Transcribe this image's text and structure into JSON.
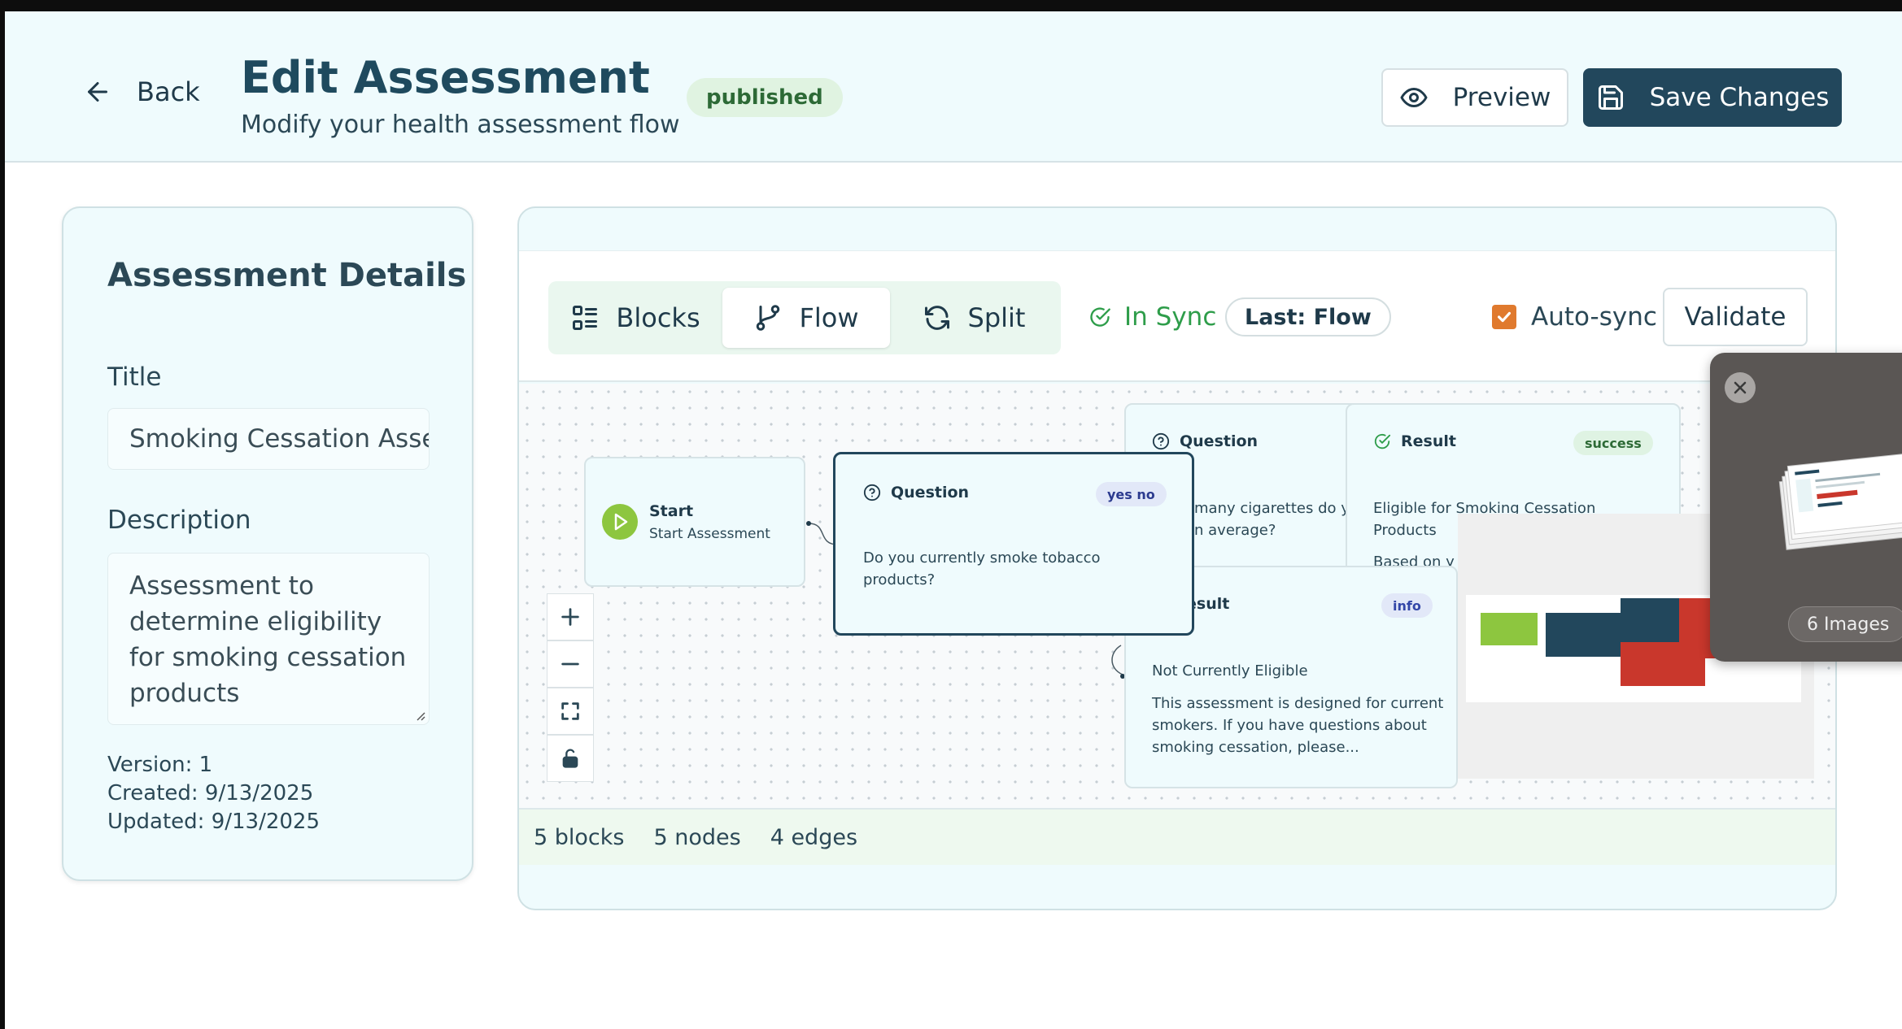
{
  "header": {
    "back_label": "Back",
    "title": "Edit Assessment",
    "subtitle": "Modify your health assessment flow",
    "status_badge": "published",
    "preview_label": "Preview",
    "save_label": "Save Changes"
  },
  "details": {
    "heading": "Assessment Details",
    "title_label": "Title",
    "title_value": "Smoking Cessation Assessment",
    "description_label": "Description",
    "description_value": "Assessment to determine eligibility for smoking cessation products",
    "version": "Version: 1",
    "created": "Created: 9/13/2025",
    "updated": "Updated: 9/13/2025"
  },
  "editor": {
    "tabs": [
      {
        "label": "Blocks",
        "icon": "blocks-icon"
      },
      {
        "label": "Flow",
        "icon": "flow-icon",
        "active": true
      },
      {
        "label": "Split",
        "icon": "split-icon"
      }
    ],
    "sync_status": "In Sync",
    "last_label": "Last: Flow",
    "autosync_label": "Auto-sync",
    "autosync_checked": true,
    "validate_label": "Validate",
    "footer": {
      "blocks": "5 blocks",
      "nodes": "5 nodes",
      "edges": "4 edges"
    }
  },
  "flow": {
    "start_node": {
      "title": "Start",
      "subtitle": "Start Assessment"
    },
    "question_main": {
      "title": "Question",
      "badge": "yes no",
      "text": "Do you currently smoke tobacco products?"
    },
    "question_2": {
      "title": "Question",
      "text_line1": "many cigarettes do yo",
      "text_line2": "n average?"
    },
    "result_success": {
      "title": "Result",
      "badge": "success",
      "text": "Eligible for Smoking Cessation Products",
      "detail": "Based on y"
    },
    "result_info": {
      "title": "esult",
      "badge": "info",
      "text": "Not Currently Eligible",
      "detail": "This assessment is designed for current smokers. If you have questions about smoking cessation, please..."
    }
  },
  "floating_preview": {
    "count_label": "6 Images"
  },
  "colors": {
    "header_bg": "#effbfd",
    "primary": "#22475c",
    "success": "#2e9d4a",
    "accent_orange": "#e07a2e",
    "start_green": "#8dc63f",
    "red": "#c9372c"
  }
}
